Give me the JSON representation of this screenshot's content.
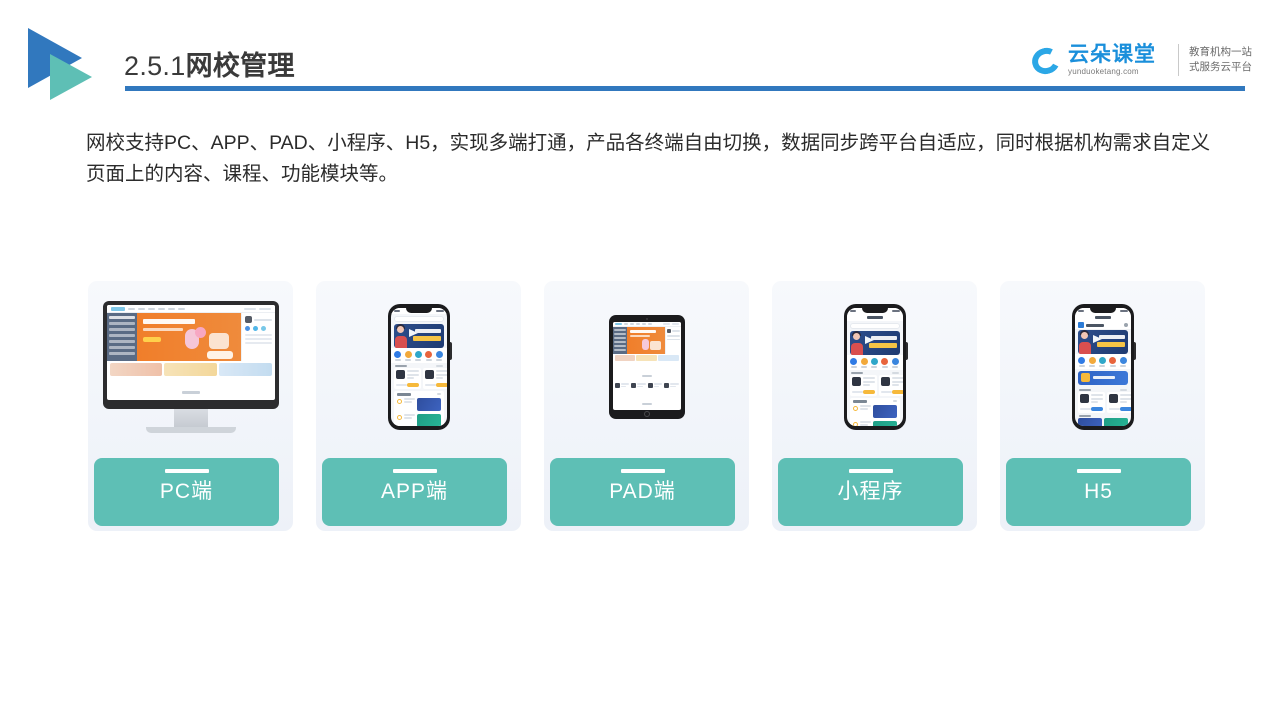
{
  "header": {
    "number": "2.5.1",
    "title_cn": "网校管理",
    "logo_mark": "triangle-play-logo",
    "rule_color": "#3178BE"
  },
  "brand": {
    "name_cn": "云朵课堂",
    "domain": "yunduoketang.com",
    "tagline_line1": "教育机构一站",
    "tagline_line2": "式服务云平台",
    "icon": "cloud-icon",
    "color": "#1A8FDB"
  },
  "body": {
    "paragraph": "网校支持PC、APP、PAD、小程序、H5，实现多端打通，产品各终端自由切换，数据同步跨平台自适应，同时根据机构需求自定义页面上的内容、课程、功能模块等。"
  },
  "cards": [
    {
      "label": "PC端",
      "device": "imac",
      "device_name": "desktop-monitor"
    },
    {
      "label": "APP端",
      "device": "phone",
      "device_name": "smartphone-app"
    },
    {
      "label": "PAD端",
      "device": "ipad",
      "device_name": "tablet"
    },
    {
      "label": "小程序",
      "device": "phone",
      "device_name": "smartphone-miniprogram"
    },
    {
      "label": "H5",
      "device": "phone",
      "device_name": "smartphone-h5"
    }
  ],
  "colors": {
    "accent_teal": "#5EBFB5",
    "accent_blue": "#3178BE",
    "card_bg_top": "#F7F9FC",
    "card_bg_bottom": "#EDF1F8",
    "banner_orange": "#F07E2A",
    "banner_navy": "#2D4E8C"
  }
}
